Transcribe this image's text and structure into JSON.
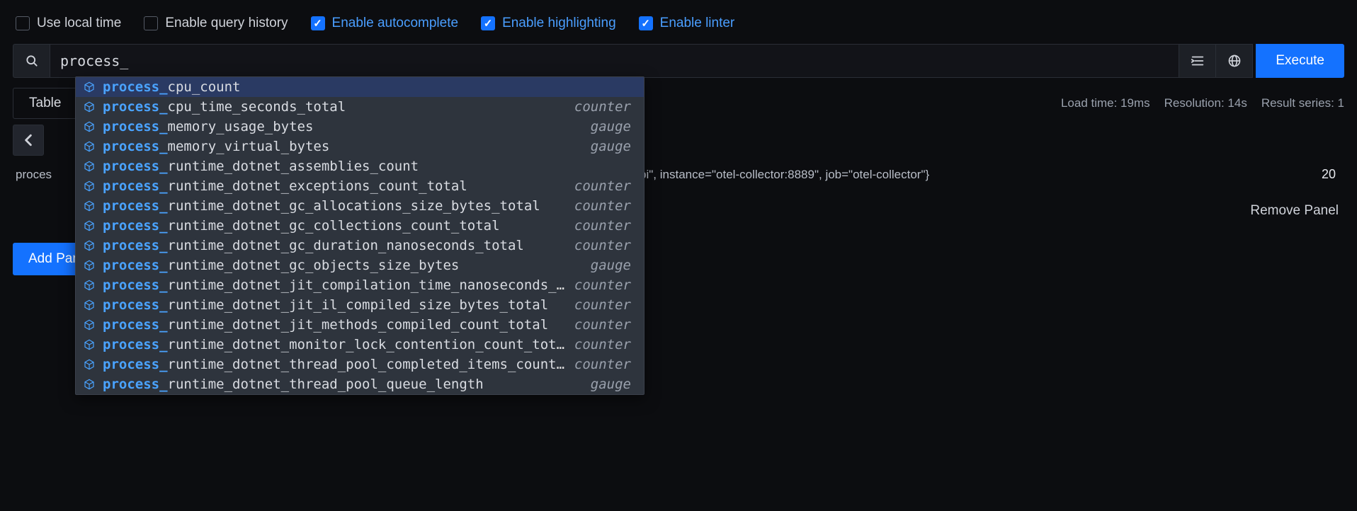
{
  "options": {
    "use_local_time": {
      "label": "Use local time",
      "checked": false
    },
    "enable_history": {
      "label": "Enable query history",
      "checked": false
    },
    "enable_autocomp": {
      "label": "Enable autocomplete",
      "checked": true
    },
    "enable_highlight": {
      "label": "Enable highlighting",
      "checked": true
    },
    "enable_linter": {
      "label": "Enable linter",
      "checked": true
    }
  },
  "query": {
    "value": "process_",
    "execute_label": "Execute"
  },
  "tabs": {
    "table_label": "Table"
  },
  "stats": {
    "load_time": "Load time: 19ms",
    "resolution": "Resolution: 14s",
    "series": "Result series: 1"
  },
  "result": {
    "prefix_metric": "proces",
    "labels": "pi\", instance=\"otel-collector:8889\", job=\"otel-collector\"}",
    "bold_keys": [
      "instance",
      "job"
    ],
    "value": "20"
  },
  "panel": {
    "remove_label": "Remove Panel",
    "add_label": "Add Panel"
  },
  "autocomplete": {
    "prefix": "process_",
    "items": [
      {
        "suffix": "cpu_count",
        "type": "",
        "selected": true
      },
      {
        "suffix": "cpu_time_seconds_total",
        "type": "counter",
        "selected": false
      },
      {
        "suffix": "memory_usage_bytes",
        "type": "gauge",
        "selected": false
      },
      {
        "suffix": "memory_virtual_bytes",
        "type": "gauge",
        "selected": false
      },
      {
        "suffix": "runtime_dotnet_assemblies_count",
        "type": "",
        "selected": false
      },
      {
        "suffix": "runtime_dotnet_exceptions_count_total",
        "type": "counter",
        "selected": false
      },
      {
        "suffix": "runtime_dotnet_gc_allocations_size_bytes_total",
        "type": "counter",
        "selected": false
      },
      {
        "suffix": "runtime_dotnet_gc_collections_count_total",
        "type": "counter",
        "selected": false
      },
      {
        "suffix": "runtime_dotnet_gc_duration_nanoseconds_total",
        "type": "counter",
        "selected": false
      },
      {
        "suffix": "runtime_dotnet_gc_objects_size_bytes",
        "type": "gauge",
        "selected": false
      },
      {
        "suffix": "runtime_dotnet_jit_compilation_time_nanoseconds_total",
        "type": "counter",
        "selected": false
      },
      {
        "suffix": "runtime_dotnet_jit_il_compiled_size_bytes_total",
        "type": "counter",
        "selected": false
      },
      {
        "suffix": "runtime_dotnet_jit_methods_compiled_count_total",
        "type": "counter",
        "selected": false
      },
      {
        "suffix": "runtime_dotnet_monitor_lock_contention_count_total",
        "type": "counter",
        "selected": false
      },
      {
        "suffix": "runtime_dotnet_thread_pool_completed_items_count_total",
        "type": "counter",
        "selected": false
      },
      {
        "suffix": "runtime_dotnet_thread_pool_queue_length",
        "type": "gauge",
        "selected": false
      }
    ]
  }
}
